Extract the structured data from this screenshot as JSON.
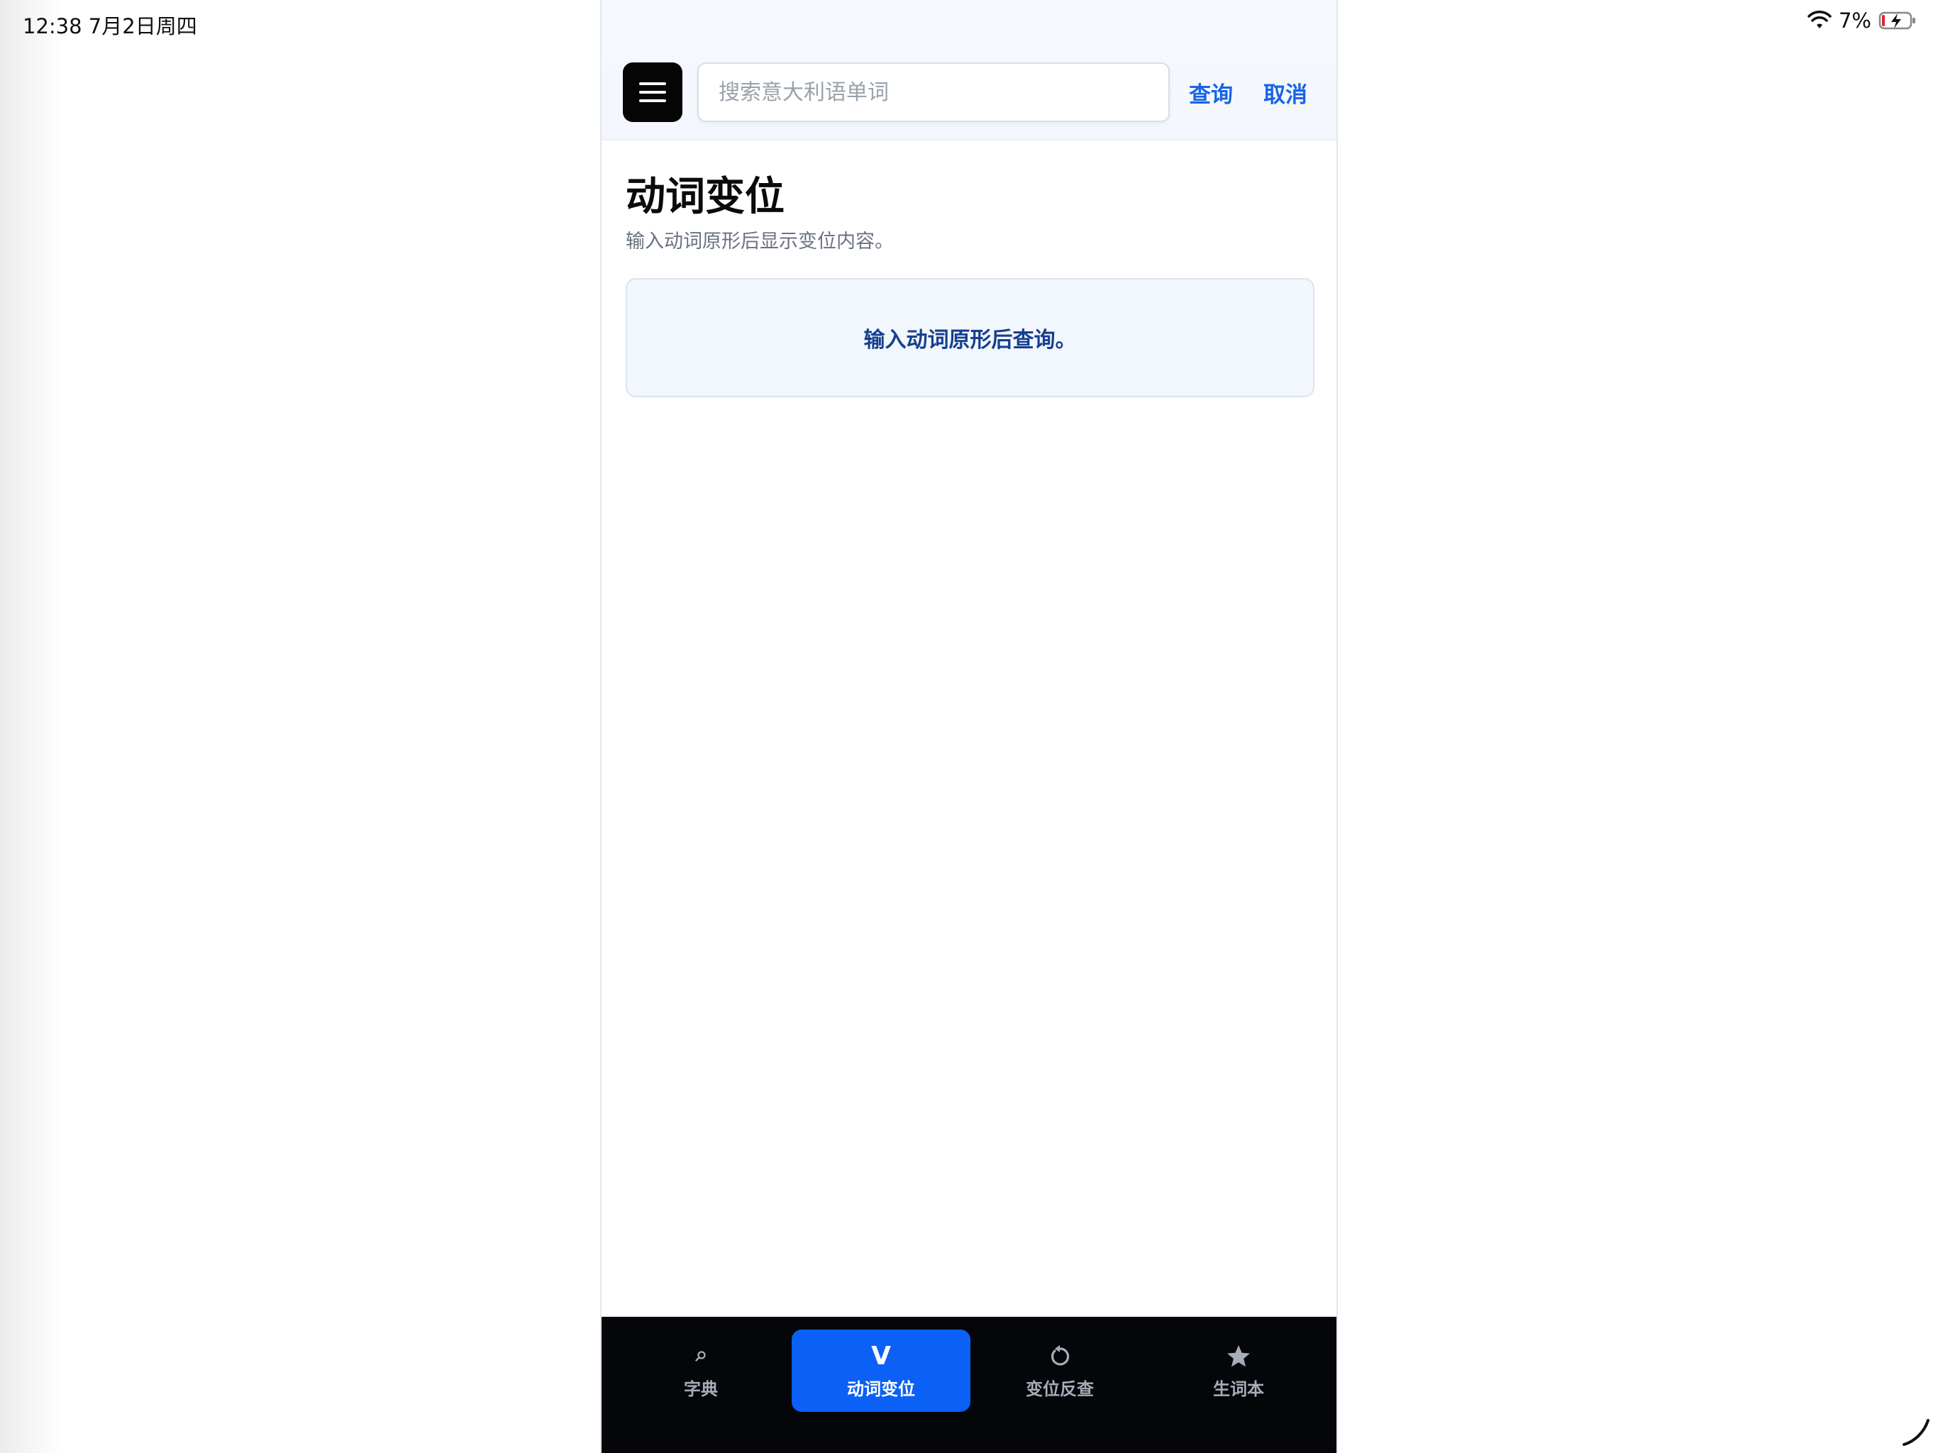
{
  "status_bar": {
    "time_date": "12:38   7月2日周四",
    "battery": "7%"
  },
  "header": {
    "search_placeholder": "搜索意大利语单词",
    "query_label": "查询",
    "cancel_label": "取消"
  },
  "main": {
    "title": "动词变位",
    "subtitle": "输入动词原形后显示变位内容。",
    "hint": "输入动词原形后查询。"
  },
  "bottom_nav": {
    "items": [
      {
        "label": "字典",
        "icon": "search-icon"
      },
      {
        "label": "动词变位",
        "icon": "v-letter-icon",
        "glyph": "V",
        "active": true
      },
      {
        "label": "变位反查",
        "icon": "rotate-icon"
      },
      {
        "label": "生词本",
        "icon": "star-icon"
      }
    ]
  },
  "colors": {
    "accent": "#0b60f5",
    "link": "#1764e8",
    "hint_text": "#163f8f",
    "nav_background": "#04060a"
  }
}
